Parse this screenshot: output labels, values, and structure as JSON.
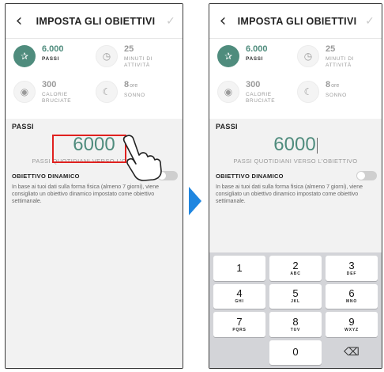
{
  "header": {
    "back_icon": "chevron-left-icon",
    "title": "IMPOSTA GLI OBIETTIVI",
    "confirm_icon": "check-icon"
  },
  "tiles": [
    {
      "icon": "footprint-icon",
      "value": "6.000",
      "unit": "",
      "label": "PASSI",
      "active": true
    },
    {
      "icon": "clock-icon",
      "value": "25",
      "unit": "",
      "label": "MINUTI DI ATTIVITÀ",
      "active": false
    },
    {
      "icon": "flame-icon",
      "value": "300",
      "unit": "",
      "label": "CALORIE BRUCIATE",
      "active": false
    },
    {
      "icon": "moon-icon",
      "value": "8",
      "unit": "ore",
      "label": "SONNO",
      "active": false
    }
  ],
  "steps_section": {
    "title": "PASSI",
    "value": "6000",
    "caption": "PASSI QUOTIDIANI VERSO L'OBIETTIVO"
  },
  "dynamic": {
    "label": "OBIETTIVO DINAMICO",
    "description": "In base ai tuoi dati sulla forma fisica (almeno 7 giorni), viene consigliato un obiettivo dinamico impostato come obiettivo settimanale.",
    "enabled": false
  },
  "keypad": [
    {
      "num": "1",
      "letters": ""
    },
    {
      "num": "2",
      "letters": "ABC"
    },
    {
      "num": "3",
      "letters": "DEF"
    },
    {
      "num": "4",
      "letters": "GHI"
    },
    {
      "num": "5",
      "letters": "JKL"
    },
    {
      "num": "6",
      "letters": "MNO"
    },
    {
      "num": "7",
      "letters": "PQRS"
    },
    {
      "num": "8",
      "letters": "TUV"
    },
    {
      "num": "9",
      "letters": "WXYZ"
    },
    {
      "num": "",
      "letters": ""
    },
    {
      "num": "0",
      "letters": ""
    },
    {
      "num": "⌫",
      "letters": ""
    }
  ],
  "colors": {
    "accent": "#4f8c7d",
    "highlight": "#e0211f",
    "arrow": "#1f86e0"
  }
}
